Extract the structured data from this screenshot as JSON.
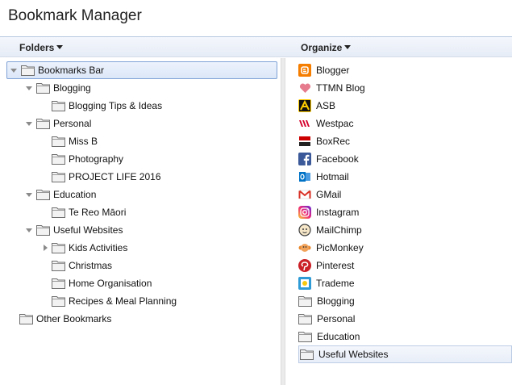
{
  "app": {
    "title": "Bookmark Manager"
  },
  "columns": {
    "folders_label": "Folders",
    "organize_label": "Organize"
  },
  "tree": {
    "bookmarks_bar": "Bookmarks Bar",
    "blogging": "Blogging",
    "blogging_tips": "Blogging Tips & Ideas",
    "personal": "Personal",
    "miss_b": "Miss B",
    "photography": "Photography",
    "project_life": "PROJECT LIFE 2016",
    "education": "Education",
    "te_reo": "Te Reo Māori",
    "useful_websites": "Useful Websites",
    "kids_activities": "Kids Activities",
    "christmas": "Christmas",
    "home_organisation": "Home Organisation",
    "recipes": "Recipes & Meal Planning",
    "other_bookmarks": "Other Bookmarks"
  },
  "bookmarks": [
    {
      "label": "Blogger",
      "icon": "blogger-icon",
      "color": "#f57d00"
    },
    {
      "label": "TTMN Blog",
      "icon": "heart-icon",
      "color": "#e57b8c"
    },
    {
      "label": "ASB",
      "icon": "asb-icon",
      "color": "#ffcc00"
    },
    {
      "label": "Westpac",
      "icon": "westpac-icon",
      "color": "#d5002b"
    },
    {
      "label": "BoxRec",
      "icon": "boxrec-icon",
      "color": "#cc0000"
    },
    {
      "label": "Facebook",
      "icon": "facebook-icon",
      "color": "#3b5998"
    },
    {
      "label": "Hotmail",
      "icon": "hotmail-icon",
      "color": "#0072c6"
    },
    {
      "label": "GMail",
      "icon": "gmail-icon",
      "color": "#d93025"
    },
    {
      "label": "Instagram",
      "icon": "instagram-icon",
      "color": "#c13584"
    },
    {
      "label": "MailChimp",
      "icon": "mailchimp-icon",
      "color": "#3d3d3d"
    },
    {
      "label": "PicMonkey",
      "icon": "picmonkey-icon",
      "color": "#e8852a"
    },
    {
      "label": "Pinterest",
      "icon": "pinterest-icon",
      "color": "#cb2027"
    },
    {
      "label": "Trademe",
      "icon": "trademe-icon",
      "color": "#2f9bd6"
    },
    {
      "label": "Blogging",
      "icon": "folder-icon"
    },
    {
      "label": "Personal",
      "icon": "folder-icon"
    },
    {
      "label": "Education",
      "icon": "folder-icon"
    },
    {
      "label": "Useful Websites",
      "icon": "folder-icon"
    }
  ]
}
